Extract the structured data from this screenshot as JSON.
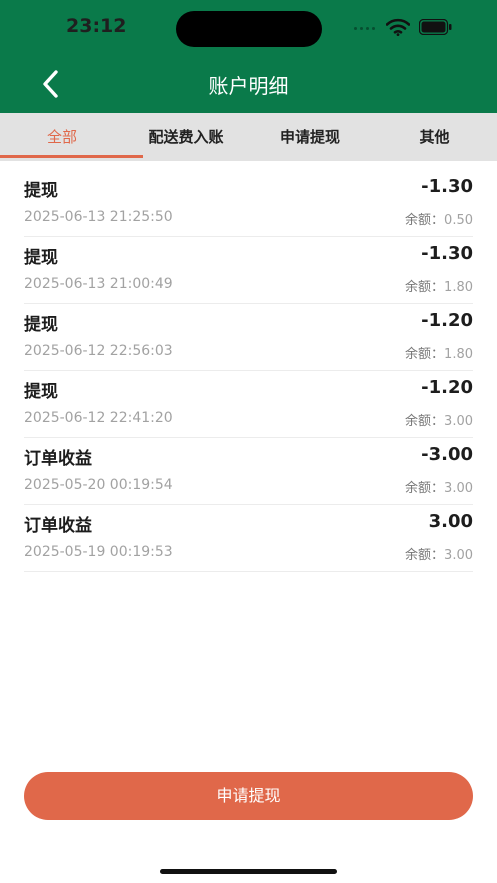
{
  "status_bar": {
    "time": "23:12"
  },
  "header": {
    "title": "账户明细"
  },
  "tabs": [
    {
      "label": "全部",
      "active": true
    },
    {
      "label": "配送费入账",
      "active": false
    },
    {
      "label": "申请提现",
      "active": false
    },
    {
      "label": "其他",
      "active": false
    }
  ],
  "records": [
    {
      "type": "提现",
      "amount": "-1.30",
      "time": "2025-06-13 21:25:50",
      "balance_label": "余额：",
      "balance": "0.50"
    },
    {
      "type": "提现",
      "amount": "-1.30",
      "time": "2025-06-13 21:00:49",
      "balance_label": "余额：",
      "balance": "1.80"
    },
    {
      "type": "提现",
      "amount": "-1.20",
      "time": "2025-06-12 22:56:03",
      "balance_label": "余额：",
      "balance": "1.80"
    },
    {
      "type": "提现",
      "amount": "-1.20",
      "time": "2025-06-12 22:41:20",
      "balance_label": "余额：",
      "balance": "3.00"
    },
    {
      "type": "订单收益",
      "amount": "-3.00",
      "time": "2025-05-20 00:19:54",
      "balance_label": "余额：",
      "balance": "3.00"
    },
    {
      "type": "订单收益",
      "amount": "3.00",
      "time": "2025-05-19 00:19:53",
      "balance_label": "余额：",
      "balance": "3.00"
    }
  ],
  "footer": {
    "withdraw_label": "申请提现"
  },
  "colors": {
    "header_green": "#0a7a4a",
    "accent_orange": "#e0684a",
    "tab_bar_gray": "#e2e2e2"
  },
  "icons": {
    "back": "chevron-left-icon",
    "wifi": "wifi-icon",
    "battery": "battery-icon"
  }
}
